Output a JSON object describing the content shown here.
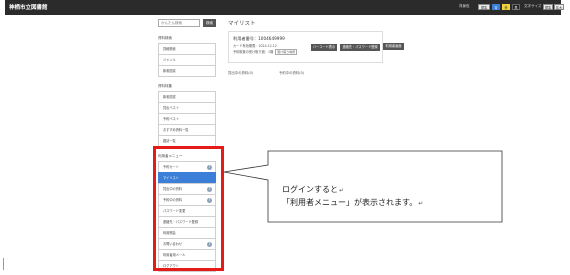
{
  "header": {
    "title": "神栖市立図書館",
    "bg_color_label": "背景色",
    "bg_options": [
      "標準",
      "青",
      "黄",
      "黒"
    ],
    "font_size_label": "文字サイズ",
    "font_options": [
      "標準",
      "拡大"
    ]
  },
  "search": {
    "placeholder": "かんたん検索",
    "button_label": "検索"
  },
  "page_title": "マイリスト",
  "sidebar": {
    "section1": {
      "heading": "資料検索",
      "items": [
        "詳細検索",
        "ジャンル",
        "新着図書"
      ]
    },
    "section2": {
      "heading": "資料特集",
      "items": [
        "新着図書",
        "貸出ベスト",
        "予約ベスト",
        "おすすめ資料一覧",
        "雑誌一覧"
      ]
    },
    "section3": {
      "heading": "利用者メニュー",
      "items": [
        {
          "label": "予約カート",
          "help": "?"
        },
        {
          "label": "マイリスト",
          "active": true
        },
        {
          "label": "貸出中の資料",
          "help": "?"
        },
        {
          "label": "予約中の資料",
          "help": "?"
        },
        {
          "label": "パスワード変更"
        },
        {
          "label": "連絡先・パスワード登録"
        },
        {
          "label": "利用照会"
        },
        {
          "label": "お問い合わせ",
          "help": "?"
        },
        {
          "label": "利用者用メール"
        },
        {
          "label": "ログアウト"
        }
      ]
    }
  },
  "card": {
    "number_text": "利用者番号：1004649999",
    "expiry_text": "カード有効期限：2024.12.12",
    "reserve_text": "予約取置の受け取り館：1階",
    "reserve_chip": "受け取り場所",
    "barcode_button": "バーコード表示",
    "idpw_button": "連絡先・パスワード登録",
    "guide_button": "利用者画面"
  },
  "counts": {
    "lent": "貸出中の資料(0)",
    "reserved": "予約中の資料(0)"
  },
  "callout": {
    "line1": "ログインすると",
    "line2": "「利用者メニュー」が表示されます。",
    "return_mark": "↵"
  },
  "colors": {
    "topbar": "#2b2b2b",
    "accent_blue": "#3c7fd8",
    "highlight_red": "#e41b17"
  }
}
